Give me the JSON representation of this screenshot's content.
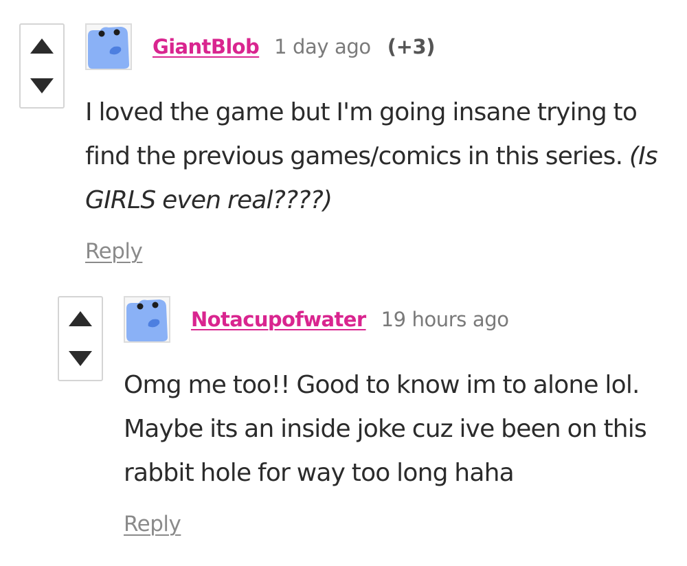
{
  "comments": [
    {
      "username": "GiantBlob",
      "timestamp": "1 day ago",
      "score": "(+3)",
      "body_main": "I loved the game but I'm going insane trying to find the previous games/comics in this series. ",
      "body_italic": "(Is GIRLS even real????)",
      "reply_label": "Reply",
      "avatar_icon": "blue-blob-avatar-icon"
    },
    {
      "username": "Notacupofwater",
      "timestamp": "19 hours ago",
      "body_main": "Omg me too!! Good to know im to alone lol. Maybe its an inside joke cuz ive been on this rabbit hole for way too long haha",
      "reply_label": "Reply",
      "avatar_icon": "blue-blob-avatar-icon"
    }
  ],
  "icons": {
    "upvote": "upvote-arrow-icon",
    "downvote": "downvote-arrow-icon"
  },
  "colors": {
    "username": "#d9258f",
    "avatar_fill": "#8ab1f6",
    "text": "#2b2b2b",
    "muted": "#7a7a7a",
    "vote_border": "#d4d4d4"
  }
}
